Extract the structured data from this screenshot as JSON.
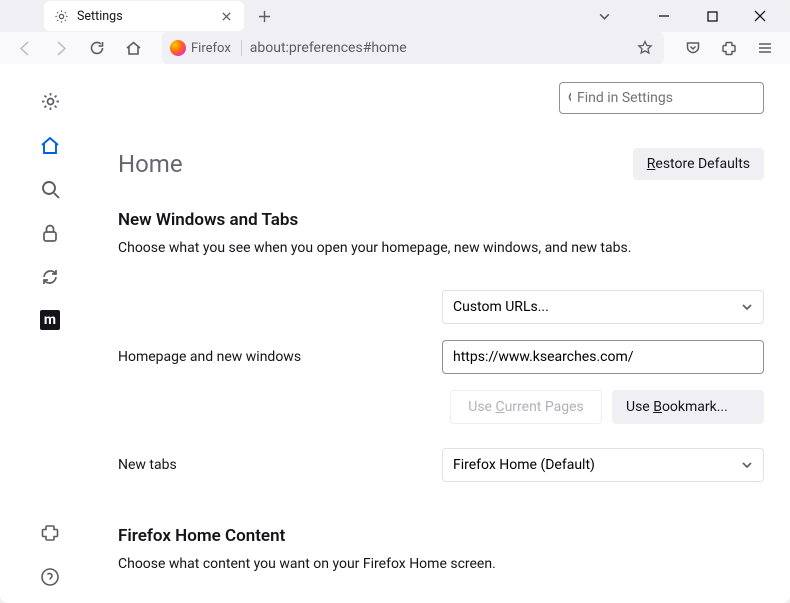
{
  "tab": {
    "label": "Settings"
  },
  "urlbar": {
    "brand": "Firefox",
    "url": "about:preferences#home"
  },
  "search": {
    "placeholder": "Find in Settings"
  },
  "page": {
    "title": "Home",
    "restore": "Restore Defaults",
    "restore_u": "R"
  },
  "section1": {
    "heading": "New Windows and Tabs",
    "desc": "Choose what you see when you open your homepage, new windows, and new tabs.",
    "dropdown1": "Custom URLs...",
    "homepage_label": "Homepage and new windows",
    "homepage_value": "https://www.ksearches.com/",
    "btn_current": "Use Current Pages",
    "btn_current_u": "C",
    "btn_bookmark": "Use Bookmark...",
    "btn_bookmark_u": "B",
    "newtabs_label": "New tabs",
    "newtabs_value": "Firefox Home (Default)"
  },
  "section2": {
    "heading": "Firefox Home Content",
    "desc": "Choose what content you want on your Firefox Home screen."
  }
}
